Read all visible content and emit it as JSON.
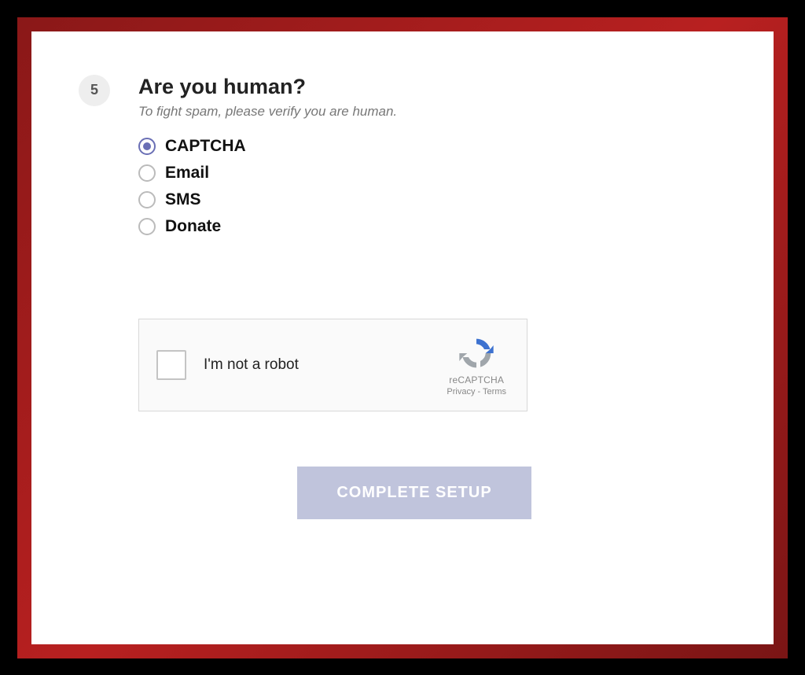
{
  "step": {
    "number": "5",
    "title": "Are you human?",
    "subtitle": "To fight spam, please verify you are human."
  },
  "options": [
    {
      "label": "CAPTCHA",
      "selected": true
    },
    {
      "label": "Email",
      "selected": false
    },
    {
      "label": "SMS",
      "selected": false
    },
    {
      "label": "Donate",
      "selected": false
    }
  ],
  "recaptcha": {
    "checkbox_label": "I'm not a robot",
    "brand": "reCAPTCHA",
    "privacy_label": "Privacy",
    "terms_label": "Terms",
    "separator": " - "
  },
  "submit": {
    "label": "COMPLETE SETUP"
  }
}
